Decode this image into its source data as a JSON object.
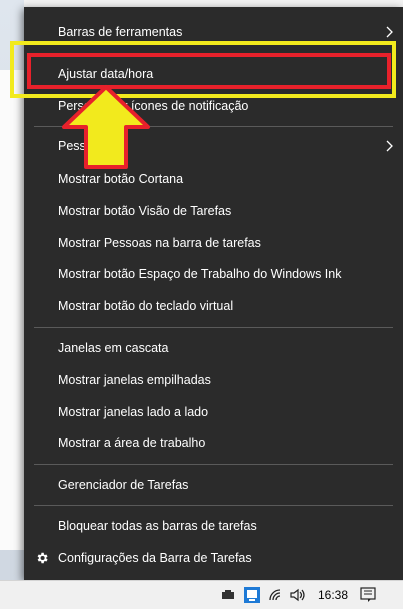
{
  "menu": {
    "items": {
      "toolbars": "Barras de ferramentas",
      "adjust_datetime": "Ajustar data/hora",
      "notification_icons": "Personalizar ícones de notificação",
      "people": "Pessoas",
      "show_cortana": "Mostrar botão Cortana",
      "show_task_view": "Mostrar botão Visão de Tarefas",
      "show_people": "Mostrar Pessoas na barra de tarefas",
      "show_ink": "Mostrar botão Espaço de Trabalho do Windows Ink",
      "show_keyboard": "Mostrar botão do teclado virtual",
      "cascade": "Janelas em cascata",
      "stacked": "Mostrar janelas empilhadas",
      "side_by_side": "Mostrar janelas lado a lado",
      "show_desktop": "Mostrar a área de trabalho",
      "task_manager": "Gerenciador de Tarefas",
      "lock_taskbars": "Bloquear todas as barras de tarefas",
      "taskbar_settings": "Configurações da Barra de Tarefas"
    }
  },
  "taskbar": {
    "time": "16:38"
  },
  "colors": {
    "menu_bg": "#2b2b2b",
    "highlight_yellow": "#f2ea1d",
    "highlight_red": "#e8212b"
  }
}
